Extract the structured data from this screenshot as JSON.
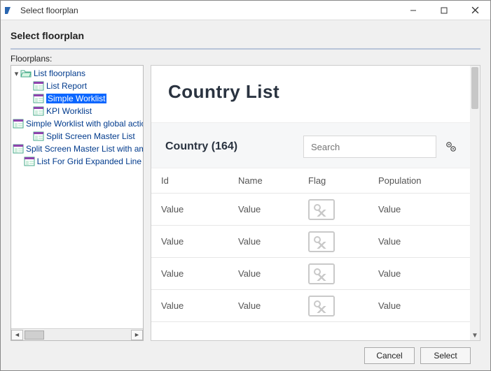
{
  "window": {
    "title": "Select floorplan",
    "heading": "Select floorplan",
    "tree_label": "Floorplans:",
    "buttons": {
      "cancel": "Cancel",
      "select": "Select"
    }
  },
  "tree": {
    "root": "List floorplans",
    "items": [
      {
        "label": "List Report",
        "selected": false
      },
      {
        "label": "Simple Worklist",
        "selected": true
      },
      {
        "label": "KPI Worklist",
        "selected": false
      },
      {
        "label": "Simple Worklist with global action",
        "selected": false
      },
      {
        "label": "Split Screen Master List",
        "selected": false
      },
      {
        "label": "Split Screen Master List with amou",
        "selected": false
      },
      {
        "label": "List For Grid Expanded Line",
        "selected": false
      }
    ]
  },
  "preview": {
    "title": "Country List",
    "subtitle": "Country (164)",
    "search_placeholder": "Search",
    "columns": [
      "Id",
      "Name",
      "Flag",
      "Population"
    ],
    "rows": [
      {
        "id": "Value",
        "name": "Value",
        "population": "Value"
      },
      {
        "id": "Value",
        "name": "Value",
        "population": "Value"
      },
      {
        "id": "Value",
        "name": "Value",
        "population": "Value"
      },
      {
        "id": "Value",
        "name": "Value",
        "population": "Value"
      }
    ]
  }
}
